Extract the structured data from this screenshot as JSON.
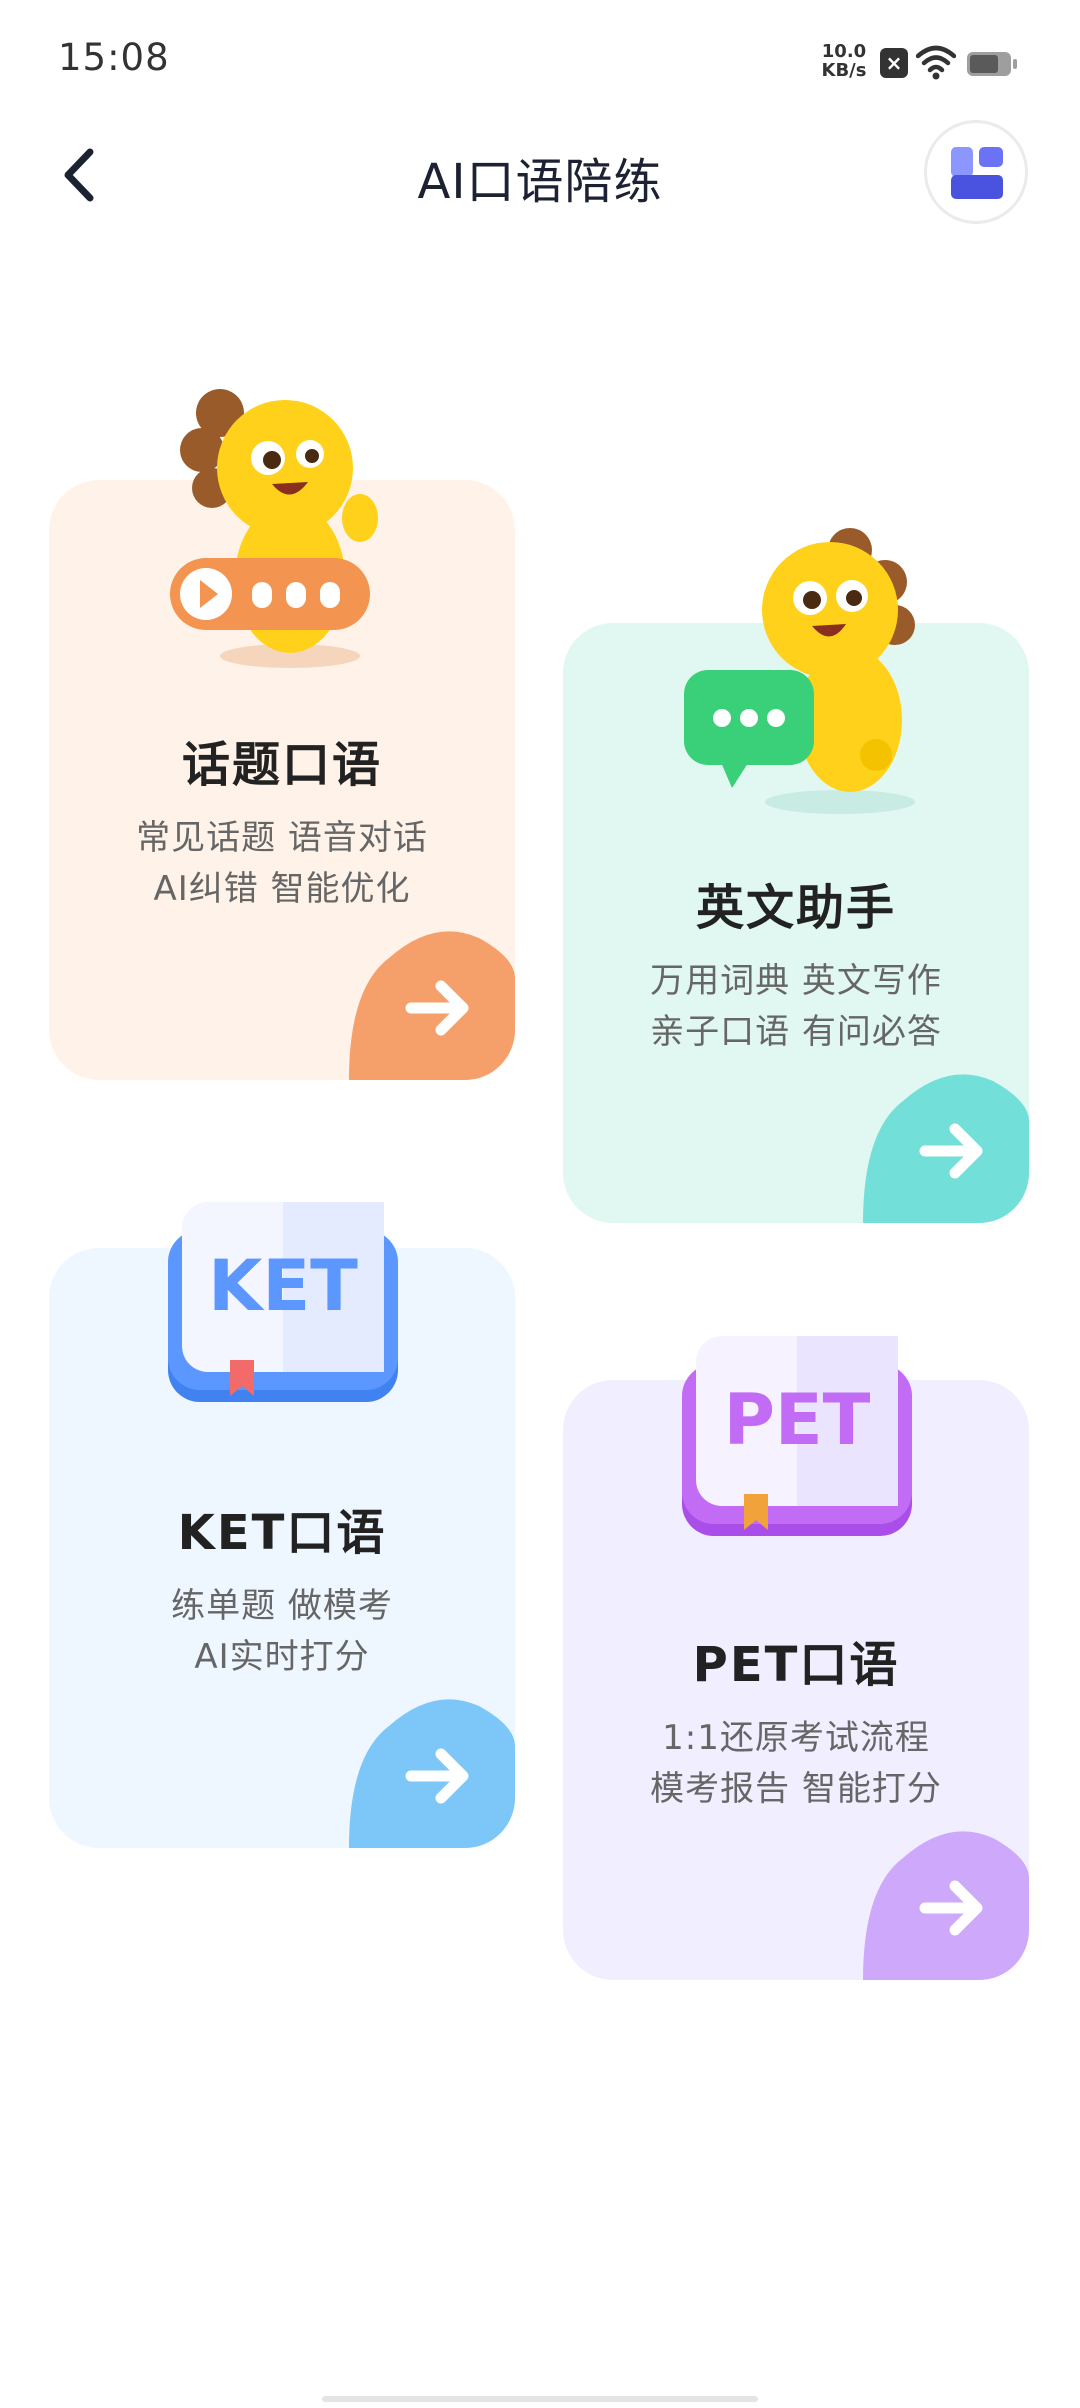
{
  "status_bar": {
    "time": "15:08",
    "net_speed_value": "10.0",
    "net_speed_unit": "KB/s",
    "icons": [
      "close-box-icon",
      "wifi-icon",
      "battery-icon"
    ]
  },
  "header": {
    "title": "AI口语陪练",
    "back_icon": "chevron-left-icon",
    "layout_icon": "layout-grid-icon"
  },
  "cards": [
    {
      "title": "话题口语",
      "desc_line1": "常见话题 语音对话",
      "desc_line2": "AI纠错 智能优化",
      "accent": "#f5a06a",
      "background": "#fff3e9"
    },
    {
      "title": "英文助手",
      "desc_line1": "万用词典 英文写作",
      "desc_line2": "亲子口语 有问必答",
      "accent": "#72dfd9",
      "background": "#e1f8f2"
    },
    {
      "title": "KET口语",
      "desc_line1": "练单题 做模考",
      "desc_line2": "AI实时打分",
      "badge": "KET",
      "accent": "#7cc6f8",
      "background": "#eef6ff"
    },
    {
      "title": "PET口语",
      "desc_line1": "1:1还原考试流程",
      "desc_line2": "模考报告 智能打分",
      "badge": "PET",
      "accent": "#cda8fb",
      "background": "#f1efff"
    }
  ]
}
